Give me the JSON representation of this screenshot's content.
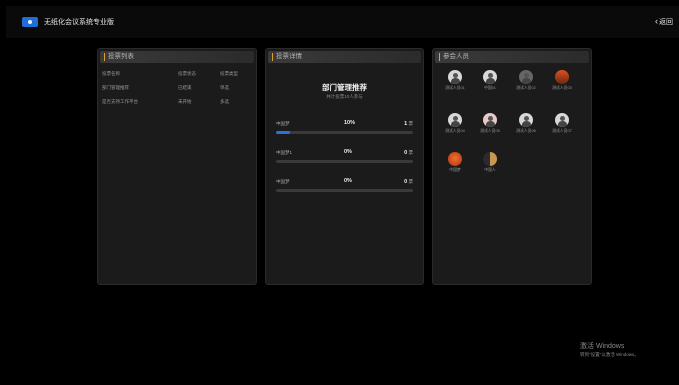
{
  "header": {
    "app_title": "无纸化会议系统专业版",
    "back_label": "返回"
  },
  "vote_list": {
    "title": "投票列表",
    "rows": [
      {
        "name": "投票名称",
        "status": "投票状态",
        "mode": "投票类型"
      },
      {
        "name": "部门管理推荐",
        "status": "已结束",
        "mode": "单选"
      },
      {
        "name": "是否支持工作平台",
        "status": "未开始",
        "mode": "多选"
      }
    ]
  },
  "vote_detail": {
    "header": "投票详情",
    "title": "部门管理推荐",
    "subtitle": "共计投票10人参与",
    "options": [
      {
        "name": "中国梦",
        "percent": "10%",
        "count": "1",
        "unit": "票",
        "fill": 0.1
      },
      {
        "name": "中国梦1",
        "percent": "0%",
        "count": "0",
        "unit": "票",
        "fill": 0
      },
      {
        "name": "中国梦",
        "percent": "0%",
        "count": "0",
        "unit": "票",
        "fill": 0
      }
    ]
  },
  "participants": {
    "title": "参会人员",
    "people": [
      {
        "name": "测试人员01",
        "avatar": "person-light"
      },
      {
        "name": "中国01",
        "avatar": "person-light"
      },
      {
        "name": "测试人员02",
        "avatar": "person-dark"
      },
      {
        "name": "测试人员03",
        "avatar": "sunset"
      },
      {
        "name": "测试人员04",
        "avatar": "person-light"
      },
      {
        "name": "测试人员05",
        "avatar": "person-pink"
      },
      {
        "name": "测试人员06",
        "avatar": "person-light"
      },
      {
        "name": "测试人员07",
        "avatar": "person-light"
      },
      {
        "name": "中国梦",
        "avatar": "orange"
      },
      {
        "name": "中国人",
        "avatar": "moon"
      }
    ]
  },
  "windows_watermark": {
    "line1": "激活 Windows",
    "line2": "转到\"设置\"以激活 Windows。"
  },
  "colors": {
    "accent": "#2f6fe0",
    "header_marker": "#e0a030",
    "background": "#000000",
    "panel": "#1b1b1b"
  }
}
